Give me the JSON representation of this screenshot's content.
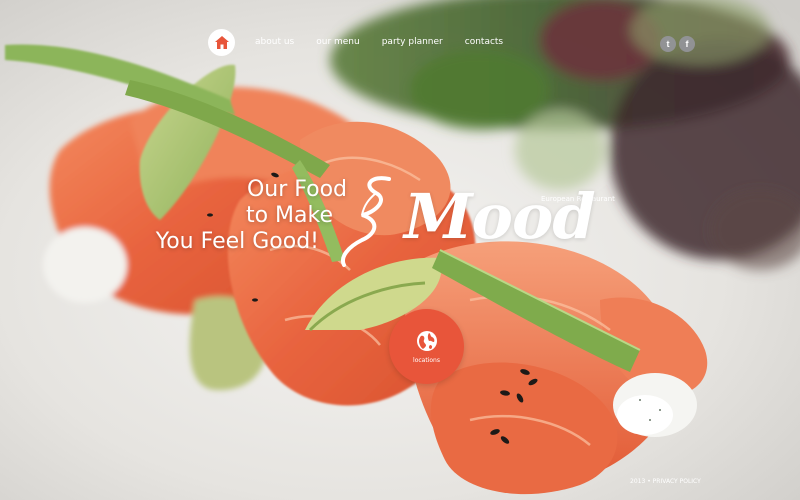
{
  "nav": {
    "home_icon": "home-icon",
    "items": [
      {
        "label": "about us"
      },
      {
        "label": "our menu"
      },
      {
        "label": "party planner"
      },
      {
        "label": "contacts"
      }
    ]
  },
  "social": {
    "twitter_icon": "twitter-icon",
    "facebook_icon": "facebook-icon",
    "twitter_glyph": "t",
    "facebook_glyph": "f"
  },
  "hero": {
    "tagline_lines": [
      "Our Food",
      "to Make",
      "You Feel Good!"
    ],
    "logo_text": "Mood",
    "logo_subtitle": "European Restaurant"
  },
  "locations": {
    "label": "locations",
    "icon": "globe-icon"
  },
  "footer": {
    "year": "2013",
    "separator": "•",
    "privacy_label": "PRIVACY POLICY"
  },
  "colors": {
    "accent": "#e8553a",
    "text": "#ffffff",
    "social_bg": "#9696a0"
  }
}
